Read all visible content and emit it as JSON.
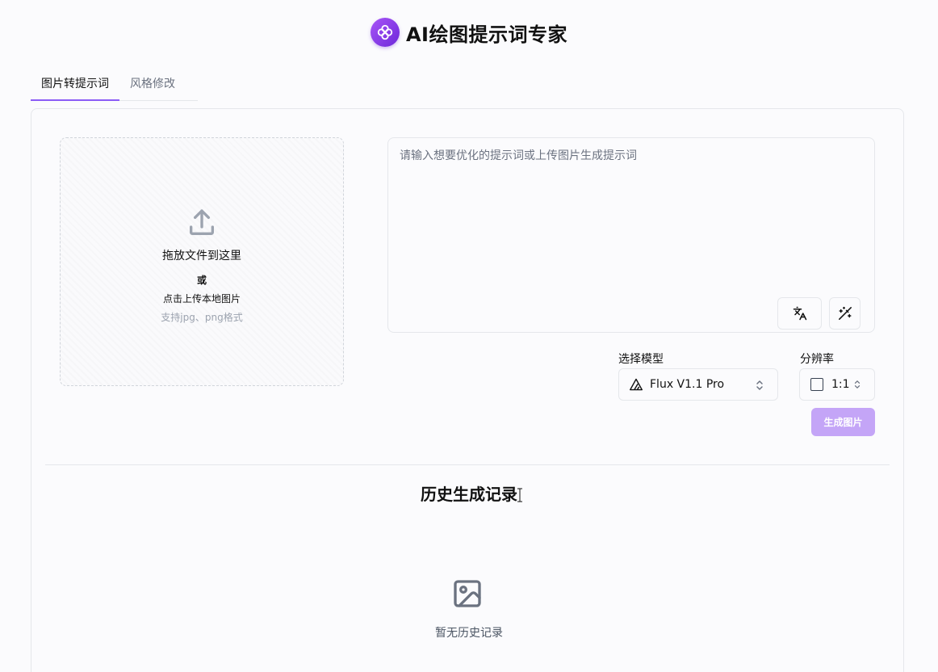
{
  "header": {
    "title": "AI绘图提示词专家",
    "logo_icon": "flower-logo-icon"
  },
  "tabs": [
    {
      "label": "图片转提示词",
      "active": true
    },
    {
      "label": "风格修改",
      "active": false
    }
  ],
  "upload": {
    "main_text": "拖放文件到这里",
    "or_text": "或",
    "click_text": "点击上传本地图片",
    "hint": "支持jpg、png格式"
  },
  "prompt": {
    "placeholder": "请输入想要优化的提示词或上传图片生成提示词",
    "value": ""
  },
  "model": {
    "label": "选择模型",
    "value": "Flux V1.1 Pro"
  },
  "resolution": {
    "label": "分辨率",
    "value": "1:1"
  },
  "generate_button": "生成图片",
  "history": {
    "title": "历史生成记录",
    "empty_text": "暂无历史记录"
  },
  "colors": {
    "accent": "#8b5cf6",
    "button_disabled": "#c4a5f7"
  }
}
